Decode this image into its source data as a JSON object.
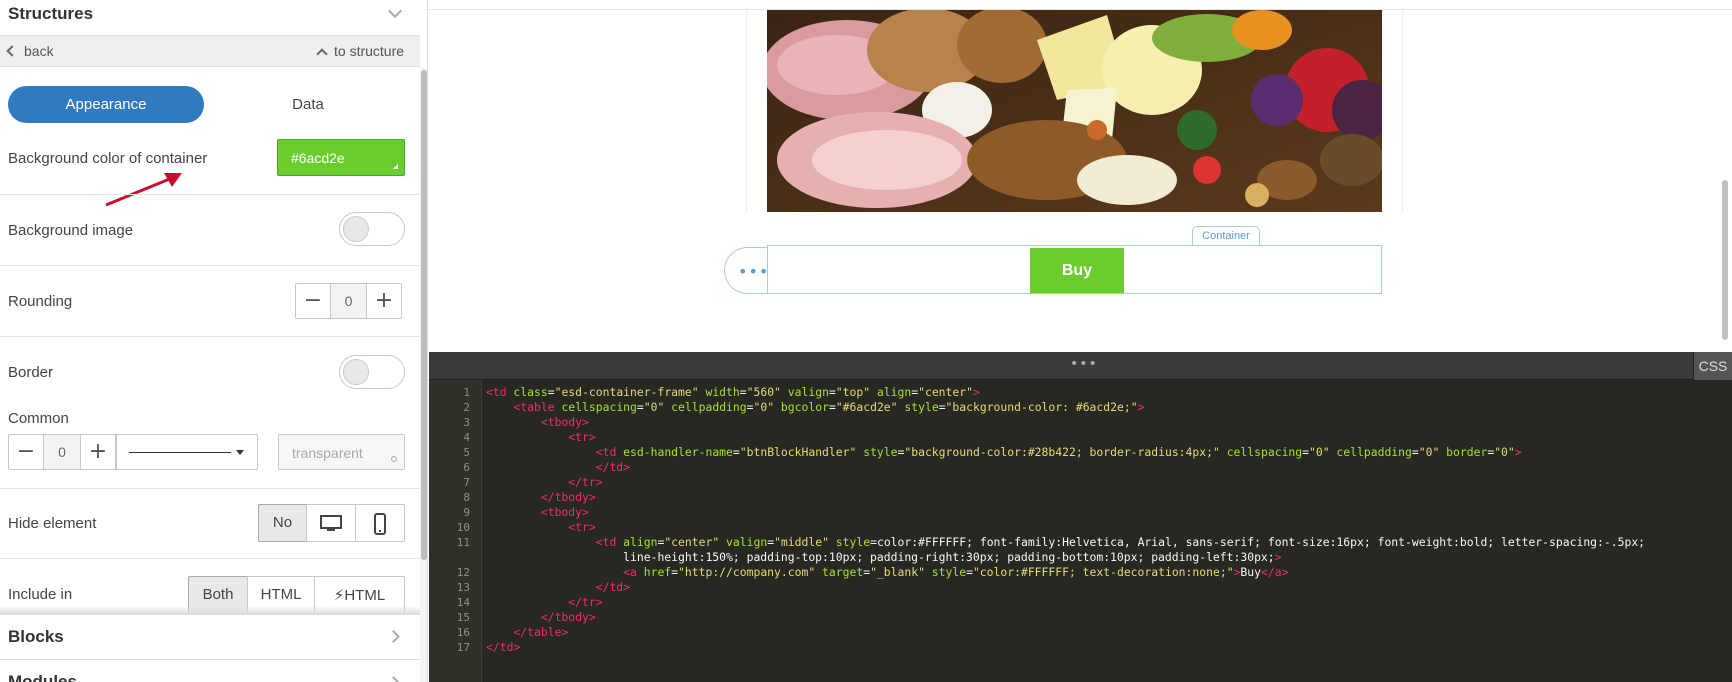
{
  "sidebar": {
    "section_title": "Structures",
    "back_label": "back",
    "to_structure_label": "to structure",
    "tabs": [
      {
        "label": "Appearance",
        "active": true
      },
      {
        "label": "Data",
        "active": false
      }
    ],
    "bg_color_label": "Background color of container",
    "bg_color_value": "#6acd2e",
    "bg_image_label": "Background image",
    "rounding_label": "Rounding",
    "rounding_value": "0",
    "border_label": "Border",
    "common_label": "Common",
    "border_width_value": "0",
    "border_color_placeholder": "transparent",
    "hide_label": "Hide element",
    "hide_options": [
      "No"
    ],
    "include_label": "Include in",
    "include_options": [
      "Both",
      "HTML",
      "HTML"
    ],
    "blocks_label": "Blocks",
    "modules_label": "Modules"
  },
  "canvas": {
    "container_badge": "Container",
    "buy_label": "Buy"
  },
  "editor": {
    "css_tab": "CSS",
    "line_numbers": [
      "1",
      "2",
      "3",
      "4",
      "5",
      "6",
      "7",
      "8",
      "9",
      "10",
      "11",
      "",
      "12",
      "13",
      "14",
      "15",
      "16",
      "17"
    ]
  },
  "colors": {
    "accent_blue": "#2f7ac0",
    "green": "#6acd2e",
    "editor_bg": "#272822",
    "arrow_red": "#c8102e"
  }
}
